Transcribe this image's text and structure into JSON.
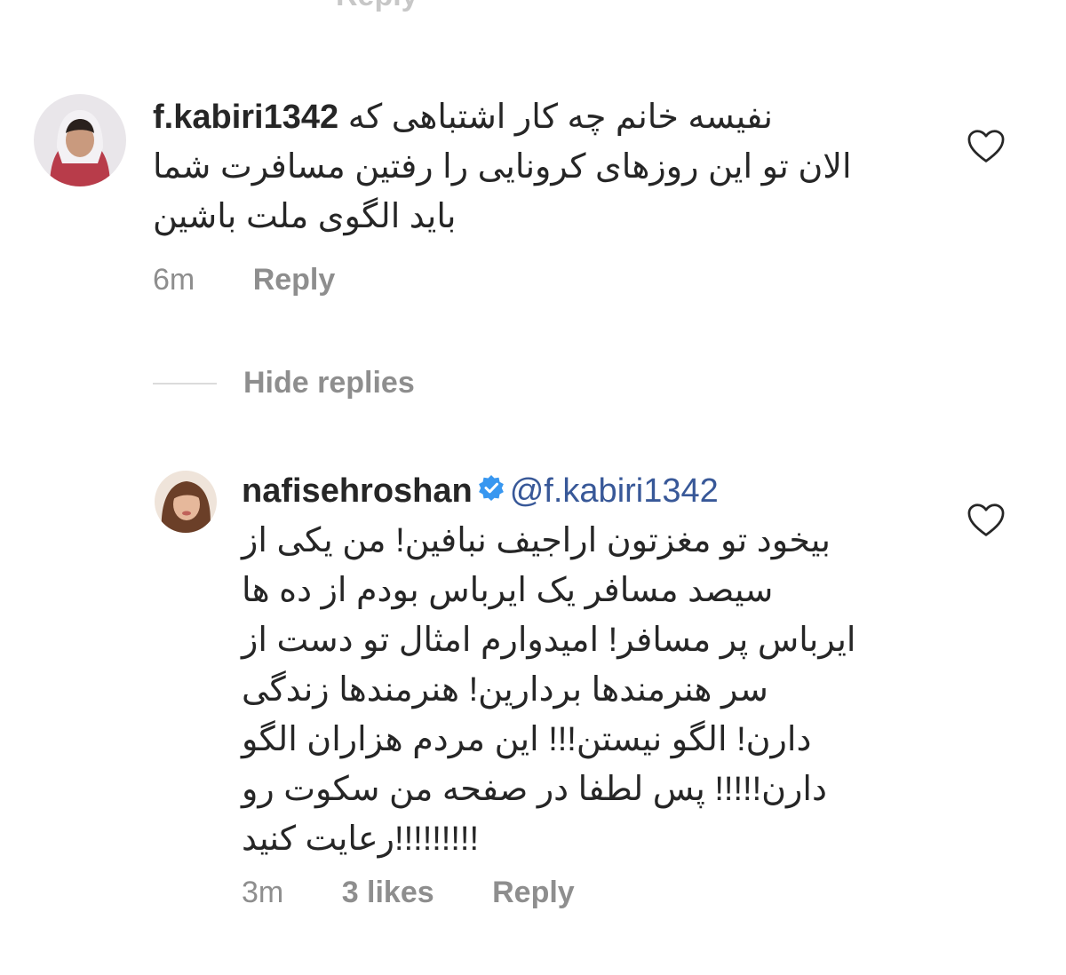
{
  "top_partial_text": "Reply",
  "comments": [
    {
      "username": "f.kabiri1342",
      "lines": [
        "نفیسه خانم چه کار اشتباهی که",
        "الان تو این روزهای کرونایی را رفتین مسافرت شما",
        "باید الگوی ملت باشین"
      ],
      "time": "6m",
      "reply_label": "Reply"
    },
    {
      "username": "nafisehroshan",
      "mention": "@f.kabiri1342",
      "verified": true,
      "lines": [
        "بیخود تو مغزتون اراجیف نبافین! من یکی از",
        "سیصد مسافر یک ایرباس بودم از ده ها",
        "ایرباس پر مسافر! امیدوارم امثال تو دست از",
        "سر هنرمندها بردارین! هنرمندها زندگی",
        "دارن! الگو نیستن!!! این مردم هزاران الگو",
        "دارن!!!!! پس لطفا در صفحه من سکوت رو",
        "!!!!!!!!!رعایت کنید"
      ],
      "time": "3m",
      "likes": "3 likes",
      "reply_label": "Reply"
    }
  ],
  "hide_replies_label": "Hide replies",
  "icons": {
    "like": "heart-outline-icon",
    "verified": "verified-badge-icon"
  },
  "colors": {
    "text": "#262626",
    "muted": "#8e8e8e",
    "mention": "#385898",
    "verified": "#3897f0"
  }
}
